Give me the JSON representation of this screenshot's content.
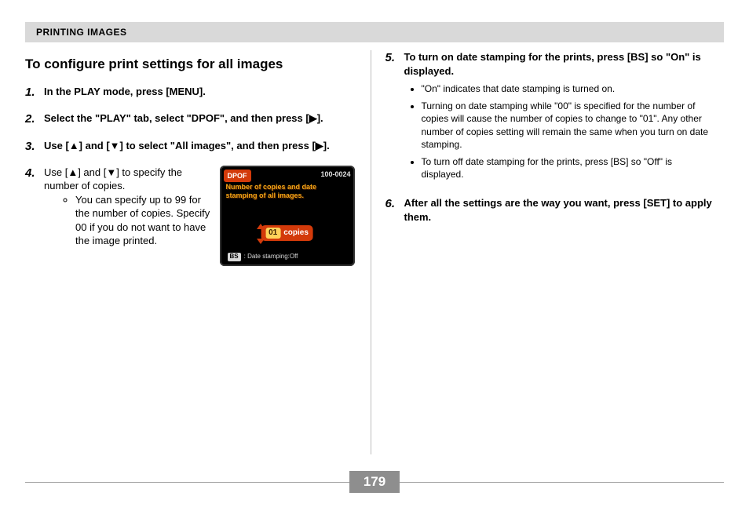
{
  "section_header": "PRINTING IMAGES",
  "page_number": "179",
  "left": {
    "heading": "To configure print settings for all images",
    "steps": [
      {
        "n": "1.",
        "text": "In the PLAY mode, press [MENU]."
      },
      {
        "n": "2.",
        "text": "Select the \"PLAY\" tab, select \"DPOF\", and then press [▶]."
      },
      {
        "n": "3.",
        "text": "Use [▲] and [▼] to select \"All images\", and then press [▶]."
      },
      {
        "n": "4.",
        "text": "Use [▲] and [▼] to specify the number of copies.",
        "bullets": [
          "You can specify up to 99 for the number of copies. Specify 00 if you do not want to have the image printed."
        ]
      }
    ]
  },
  "right": {
    "steps": [
      {
        "n": "5.",
        "text": "To turn on date stamping for the prints, press [BS] so \"On\" is displayed.",
        "bullets": [
          "\"On\" indicates that date stamping is turned on.",
          "Turning on date stamping while \"00\" is specified for the number of copies will cause the number of copies to change to \"01\". Any other number of copies setting will remain the same when you turn on date stamping.",
          "To turn off date stamping for the prints, press [BS] so \"Off\" is displayed."
        ]
      },
      {
        "n": "6.",
        "text": "After all the settings are the way you want, press [SET] to apply them."
      }
    ]
  },
  "screen": {
    "tag": "DPOF",
    "fileno": "100-0024",
    "banner1": "Number of copies and date",
    "banner2": "stamping of all images.",
    "count": "01",
    "copies_label": "copies",
    "bs_label": "BS",
    "foot_text": ": Date stamping:Off"
  }
}
